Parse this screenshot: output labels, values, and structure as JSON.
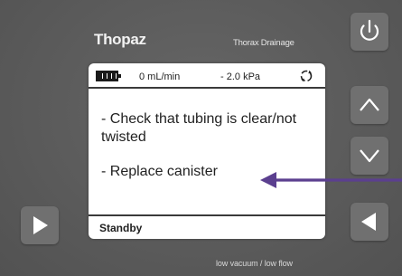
{
  "device": {
    "brand": "Thopaz",
    "mode": "Thorax Drainage",
    "footer": "low vacuum / low flow"
  },
  "screen": {
    "flow": "0 mL/min",
    "pressure": "- 2.0 kPa",
    "messages": [
      "- Check that tubing is clear/not twisted",
      "- Replace canister"
    ],
    "status": "Standby",
    "battery_level": 1.0
  },
  "icons": {
    "power": "power-icon",
    "up": "chevron-up-icon",
    "down": "chevron-down-icon",
    "back": "triangle-left-icon",
    "play": "triangle-right-icon",
    "sync": "sync-icon",
    "battery": "battery-icon"
  },
  "colors": {
    "annotation_arrow": "#5b3f8f"
  }
}
